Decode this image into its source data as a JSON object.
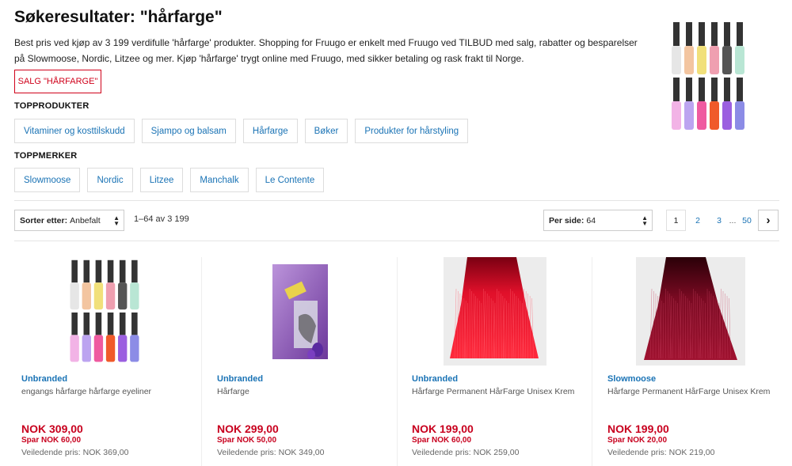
{
  "header": {
    "title": "Søkeresultater: \"hårfarge\"",
    "description": "Best pris ved kjøp av 3 199 verdifulle 'hårfarge' produkter. Shopping for Fruugo er enkelt med Fruugo ved TILBUD med salg, rabatter og besparelser på Slowmoose, Nordic, Litzee og mer. Kjøp 'hårfarge' trygt online med Fruugo, med sikker betaling og rask frakt til Norge.",
    "sale_button": "SALG \"HÅRFARGE\""
  },
  "top_products": {
    "heading": "TOPPRODUKTER",
    "items": [
      "Vitaminer og kosttilskudd",
      "Sjampo og balsam",
      "Hårfarge",
      "Bøker",
      "Produkter for hårstyling"
    ]
  },
  "top_brands": {
    "heading": "TOPPMERKER",
    "items": [
      "Slowmoose",
      "Nordic",
      "Litzee",
      "Manchalk",
      "Le Contente"
    ]
  },
  "toolbar": {
    "sort_label": "Sorter etter:",
    "sort_value": "Anbefalt",
    "result_count": "1–64 av 3 199",
    "per_page_label": "Per side:",
    "per_page_value": "64",
    "pages": [
      "1",
      "2",
      "3",
      "...",
      "50"
    ],
    "next": "›"
  },
  "products": [
    {
      "brand": "Unbranded",
      "name": "engangs hårfarge hårfarge eyeliner",
      "price": "NOK 309,00",
      "save": "Spar NOK 60,00",
      "rrp": "Veiledende pris: NOK 369,00"
    },
    {
      "brand": "Unbranded",
      "name": "Hårfarge",
      "price": "NOK 299,00",
      "save": "Spar NOK 50,00",
      "rrp": "Veiledende pris: NOK 349,00"
    },
    {
      "brand": "Unbranded",
      "name": "Hårfarge Permanent HårFarge Unisex Krem",
      "price": "NOK 199,00",
      "save": "Spar NOK 60,00",
      "rrp": "Veiledende pris: NOK 259,00"
    },
    {
      "brand": "Slowmoose",
      "name": "Hårfarge Permanent HårFarge Unisex Krem",
      "price": "NOK 199,00",
      "save": "Spar NOK 20,00",
      "rrp": "Veiledende pris: NOK 219,00"
    }
  ],
  "colors": {
    "accent_red": "#d0021b",
    "link_blue": "#1a73b5",
    "price_red": "#c8001e"
  }
}
